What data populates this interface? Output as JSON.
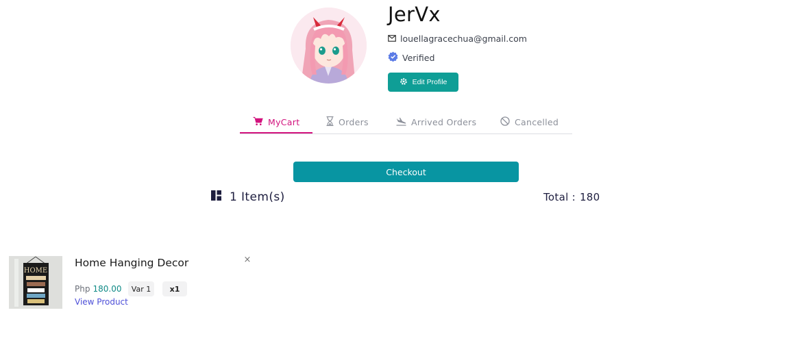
{
  "profile": {
    "username": "JerVx",
    "email": "louellagracechua@gmail.com",
    "verified_label": "Verified",
    "edit_button_label": "Edit Profile",
    "icons": {
      "email": "mail-icon",
      "verified": "verified-badge-icon",
      "edit": "gear-icon"
    }
  },
  "tabs": [
    {
      "label": "MyCart",
      "icon": "cart-icon",
      "active": true
    },
    {
      "label": "Orders",
      "icon": "hourglass-icon",
      "active": false
    },
    {
      "label": "Arrived Orders",
      "icon": "plane-landing-icon",
      "active": false
    },
    {
      "label": "Cancelled",
      "icon": "cancel-icon",
      "active": false
    }
  ],
  "cart": {
    "checkout_label": "Checkout",
    "items_count_label": "1 Item(s)",
    "total_label": "Total :",
    "total_value": "180",
    "items": [
      {
        "name": "Home Hanging Decor",
        "currency": "Php",
        "price": "180.00",
        "variant": "Var 1",
        "quantity": "x1",
        "view_label": "View Product",
        "remove_symbol": "×"
      }
    ]
  },
  "colors": {
    "accent_tab": "#d2127d",
    "edit_button": "#0f9e96",
    "checkout_button": "#0895a2",
    "price": "#0f8a86",
    "link": "#4d4fd8",
    "verified_badge": "#5b7be6"
  }
}
